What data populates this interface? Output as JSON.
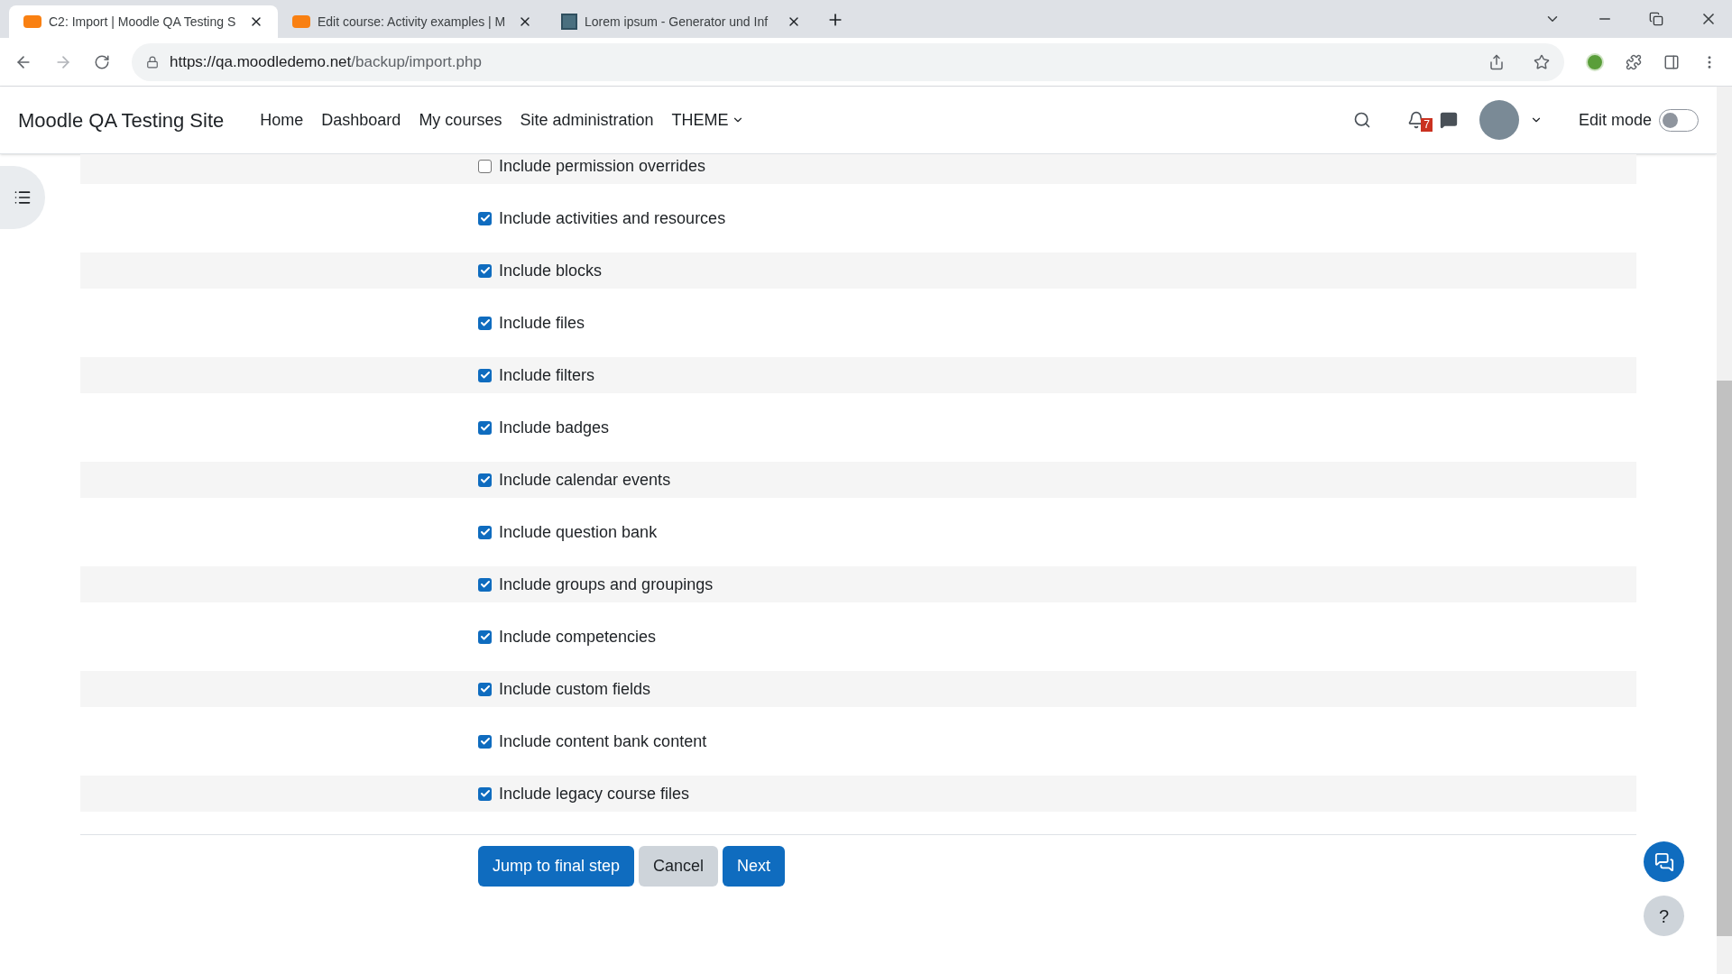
{
  "browser": {
    "tabs": [
      {
        "title": "C2: Import | Moodle QA Testing S",
        "selected": true,
        "kind": "moodle"
      },
      {
        "title": "Edit course: Activity examples | M",
        "selected": false,
        "kind": "moodle"
      },
      {
        "title": "Lorem ipsum - Generator und Inf",
        "selected": false,
        "kind": "lorem"
      }
    ],
    "url_host": "https://qa.moodledemo.net",
    "url_path": "/backup/import.php"
  },
  "header": {
    "site_name": "Moodle QA Testing Site",
    "nav": [
      "Home",
      "Dashboard",
      "My courses",
      "Site administration",
      "THEME"
    ],
    "notification_count": "7",
    "edit_mode_label": "Edit mode",
    "edit_mode_on": false
  },
  "settings": [
    {
      "label": "Include permission overrides",
      "checked": false
    },
    {
      "label": "Include activities and resources",
      "checked": true
    },
    {
      "label": "Include blocks",
      "checked": true
    },
    {
      "label": "Include files",
      "checked": true
    },
    {
      "label": "Include filters",
      "checked": true
    },
    {
      "label": "Include badges",
      "checked": true
    },
    {
      "label": "Include calendar events",
      "checked": true
    },
    {
      "label": "Include question bank",
      "checked": true
    },
    {
      "label": "Include groups and groupings",
      "checked": true
    },
    {
      "label": "Include competencies",
      "checked": true
    },
    {
      "label": "Include custom fields",
      "checked": true
    },
    {
      "label": "Include content bank content",
      "checked": true
    },
    {
      "label": "Include legacy course files",
      "checked": true
    }
  ],
  "buttons": [
    {
      "label": "Jump to final step",
      "kind": "primary"
    },
    {
      "label": "Cancel",
      "kind": "secondary"
    },
    {
      "label": "Next",
      "kind": "primary"
    }
  ],
  "help_label": "?"
}
